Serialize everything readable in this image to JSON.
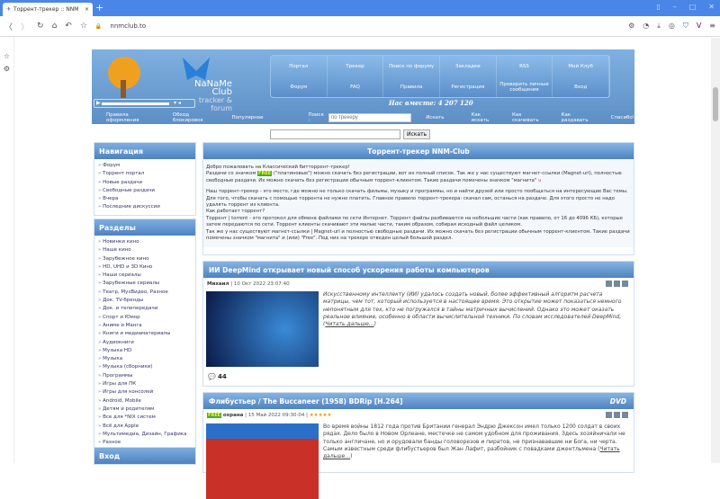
{
  "browser": {
    "tab_title": "Торрент-трекер :: NNM",
    "url": "nnmclub.to"
  },
  "header": {
    "brand": "NaNaMe Club",
    "tagline": "tracker & forum",
    "together": "Нас вместе: 4 207 120",
    "menu": [
      "Портал",
      "Трекер",
      "Поиск по форуму",
      "Закладки",
      "RSS",
      "Мой Клуб",
      "Форум",
      "FAQ",
      "Правила",
      "Регистрация",
      "Проверить личные сообщения",
      "Вход"
    ],
    "links": [
      "Правила оформления",
      "Обход блокировок",
      "Популярное"
    ],
    "search_label": "Поиск :",
    "search_placeholder": "по трекеру",
    "search_button": "Искать",
    "links2": [
      "Как искать",
      "Как скачивать",
      "Как раздавать",
      "Спасибо!"
    ]
  },
  "top_search": {
    "button": "Искать"
  },
  "navigation": {
    "title": "Навигация",
    "items": [
      "Форум",
      "Торрент портал",
      "Новые раздачи",
      "Свободные раздачи",
      "Вчера",
      "Последние дискуссии"
    ]
  },
  "sections": {
    "title": "Разделы",
    "items": [
      "Новинки кино",
      "Наше кино",
      "Зарубежное кино",
      "HD, UHD и 3D Кино",
      "Наши сериалы",
      "Зарубежные сериалы",
      "Театр, МузВидео, Разное",
      "Док. TV-бренды",
      "Док. и телепередачи",
      "Спорт и Юмор",
      "Аниме и Манга",
      "Книги и медиаматериалы",
      "Аудиокниги",
      "Музыка HD",
      "Музыка",
      "Музыка (сборники)",
      "Программы",
      "Игры для ПК",
      "Игры для консолей",
      "Android, Mobile",
      "Детям и родителям",
      "Все для *NIX систем",
      "Всё для Apple",
      "Мультимедиа, Дизайн, Графика",
      "Разное"
    ]
  },
  "login": {
    "title": "Вход"
  },
  "intro": {
    "title": "Торрент-трекер NNM-Club",
    "p1": "Добро пожаловать на Классический битторрент-трекер!",
    "p2a": "Раздачи со значком",
    "free": "FREE",
    "p2b": "(\"платиновые\") можно скачать без регистрации, вот их полный список. Так же у нас существуют магнет-ссылки (Magnet-url), полностью свободные раздачи. Их можно скачать без регистрации обычным торрент-клиентом. Такие раздачи помечены значком \"магнита\"",
    "p3": "Наш торрент-трекер - это место, где можно не только скачать фильмы, музыку и программы, но и найти друзей или просто пообщаться на интересующие Вас темы. Для того, чтобы скачать с помощью торрента не нужно платить. Главное правило торрент-трекера: скачал сам, останься на раздаче. Для этого просто не надо удалять торрент из клиента.",
    "p4": "Как работает торрент?",
    "p5": "Торрент | torrent - это протокол для обмена файлами по сети Интернет. Торрент файлы разбиваются на небольшие части (как правило, от 16 до 4096 КБ), которые затем передаются по сети. Торрент клиенты скачивают эти малые части, таким образом, собирая исходный файл целиком.",
    "p6": "Так же у нас существуют магнет-ссылки | Magnet-url и полностью свободные раздачи. Их можно скачать без регистрации обычным торрент-клиентом. Такие раздачи помечены значком \"магнита\" и (или) \"Free\". Под них на трекере отведен целый большой раздел."
  },
  "posts": [
    {
      "title": "ИИ DeepMind открывает новый способ ускорения работы компьютеров",
      "author": "Михаил",
      "date": "10 Окт 2022 23:07:40",
      "text": "Искусственному интеллекту (ИИ) удалось создать новый, более эффективный алгоритм расчета матрицы, чем тот, который используется в настоящее время. Это открытие может показаться немного непонятным для тех, кто не погружался в тайны матричных вычислений. Однако это может оказать реальное влияние, особенно в области вычислительной техники. По словам исследователей DeepMind, (",
      "more": "Читать дальше...",
      "comments": "44"
    },
    {
      "title": "Флибустьер / The Buccaneer (1958) BDRip [H.264]",
      "badge": "FREE",
      "author": "охрана",
      "date": "15 Май 2022 09:30:04",
      "stars": "★★★★★",
      "text": "Во время войны 1812 года против Британии генерал Эндрю Джексон имел только 1200 солдат в своих рядах. Дело было в Новом Орлеане, местечке не самом удобном для проживания. Здесь хозяйничали не только англичане, но и орудовали банды головорезов и пиратов, не признававшие ни Бога, ни черта. Самым известным среди флибустьеров был Жан Лафит, разбойник с повадками джентльмена (",
      "more": "Читать дальше..."
    }
  ]
}
